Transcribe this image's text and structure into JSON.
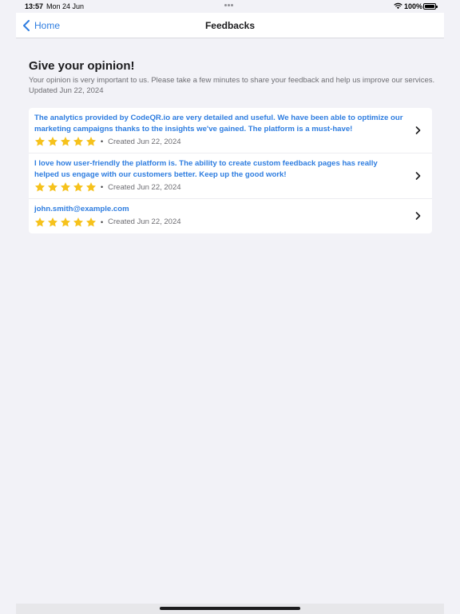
{
  "status_bar": {
    "time": "13:57",
    "date": "Mon 24 Jun",
    "battery": "100%"
  },
  "nav": {
    "back_label": "Home",
    "title": "Feedbacks"
  },
  "header": {
    "title": "Give your opinion!",
    "description": "Your opinion is very important to us. Please take a few minutes to share your feedback and help us improve our services.",
    "updated": "Updated Jun 22, 2024"
  },
  "feedbacks": [
    {
      "text": "The analytics provided by CodeQR.io are very detailed and useful. We have been able to optimize our marketing campaigns thanks to the insights we've gained. The platform is a must-have!",
      "rating": 5,
      "separator": "•",
      "created": "Created Jun 22, 2024"
    },
    {
      "text": "I love how user-friendly the platform is. The ability to create custom feedback pages has really helped us engage with our customers better. Keep up the good work!",
      "rating": 5,
      "separator": "•",
      "created": "Created Jun 22, 2024"
    },
    {
      "text": "john.smith@example.com",
      "rating": 5,
      "separator": "•",
      "created": "Created Jun 22, 2024"
    }
  ],
  "colors": {
    "accent": "#2e7de0",
    "star": "#f6c21c",
    "background": "#f2f2f7"
  },
  "icons": {
    "back": "chevron-left-icon",
    "row": "chevron-right-icon",
    "star": "star-icon"
  }
}
